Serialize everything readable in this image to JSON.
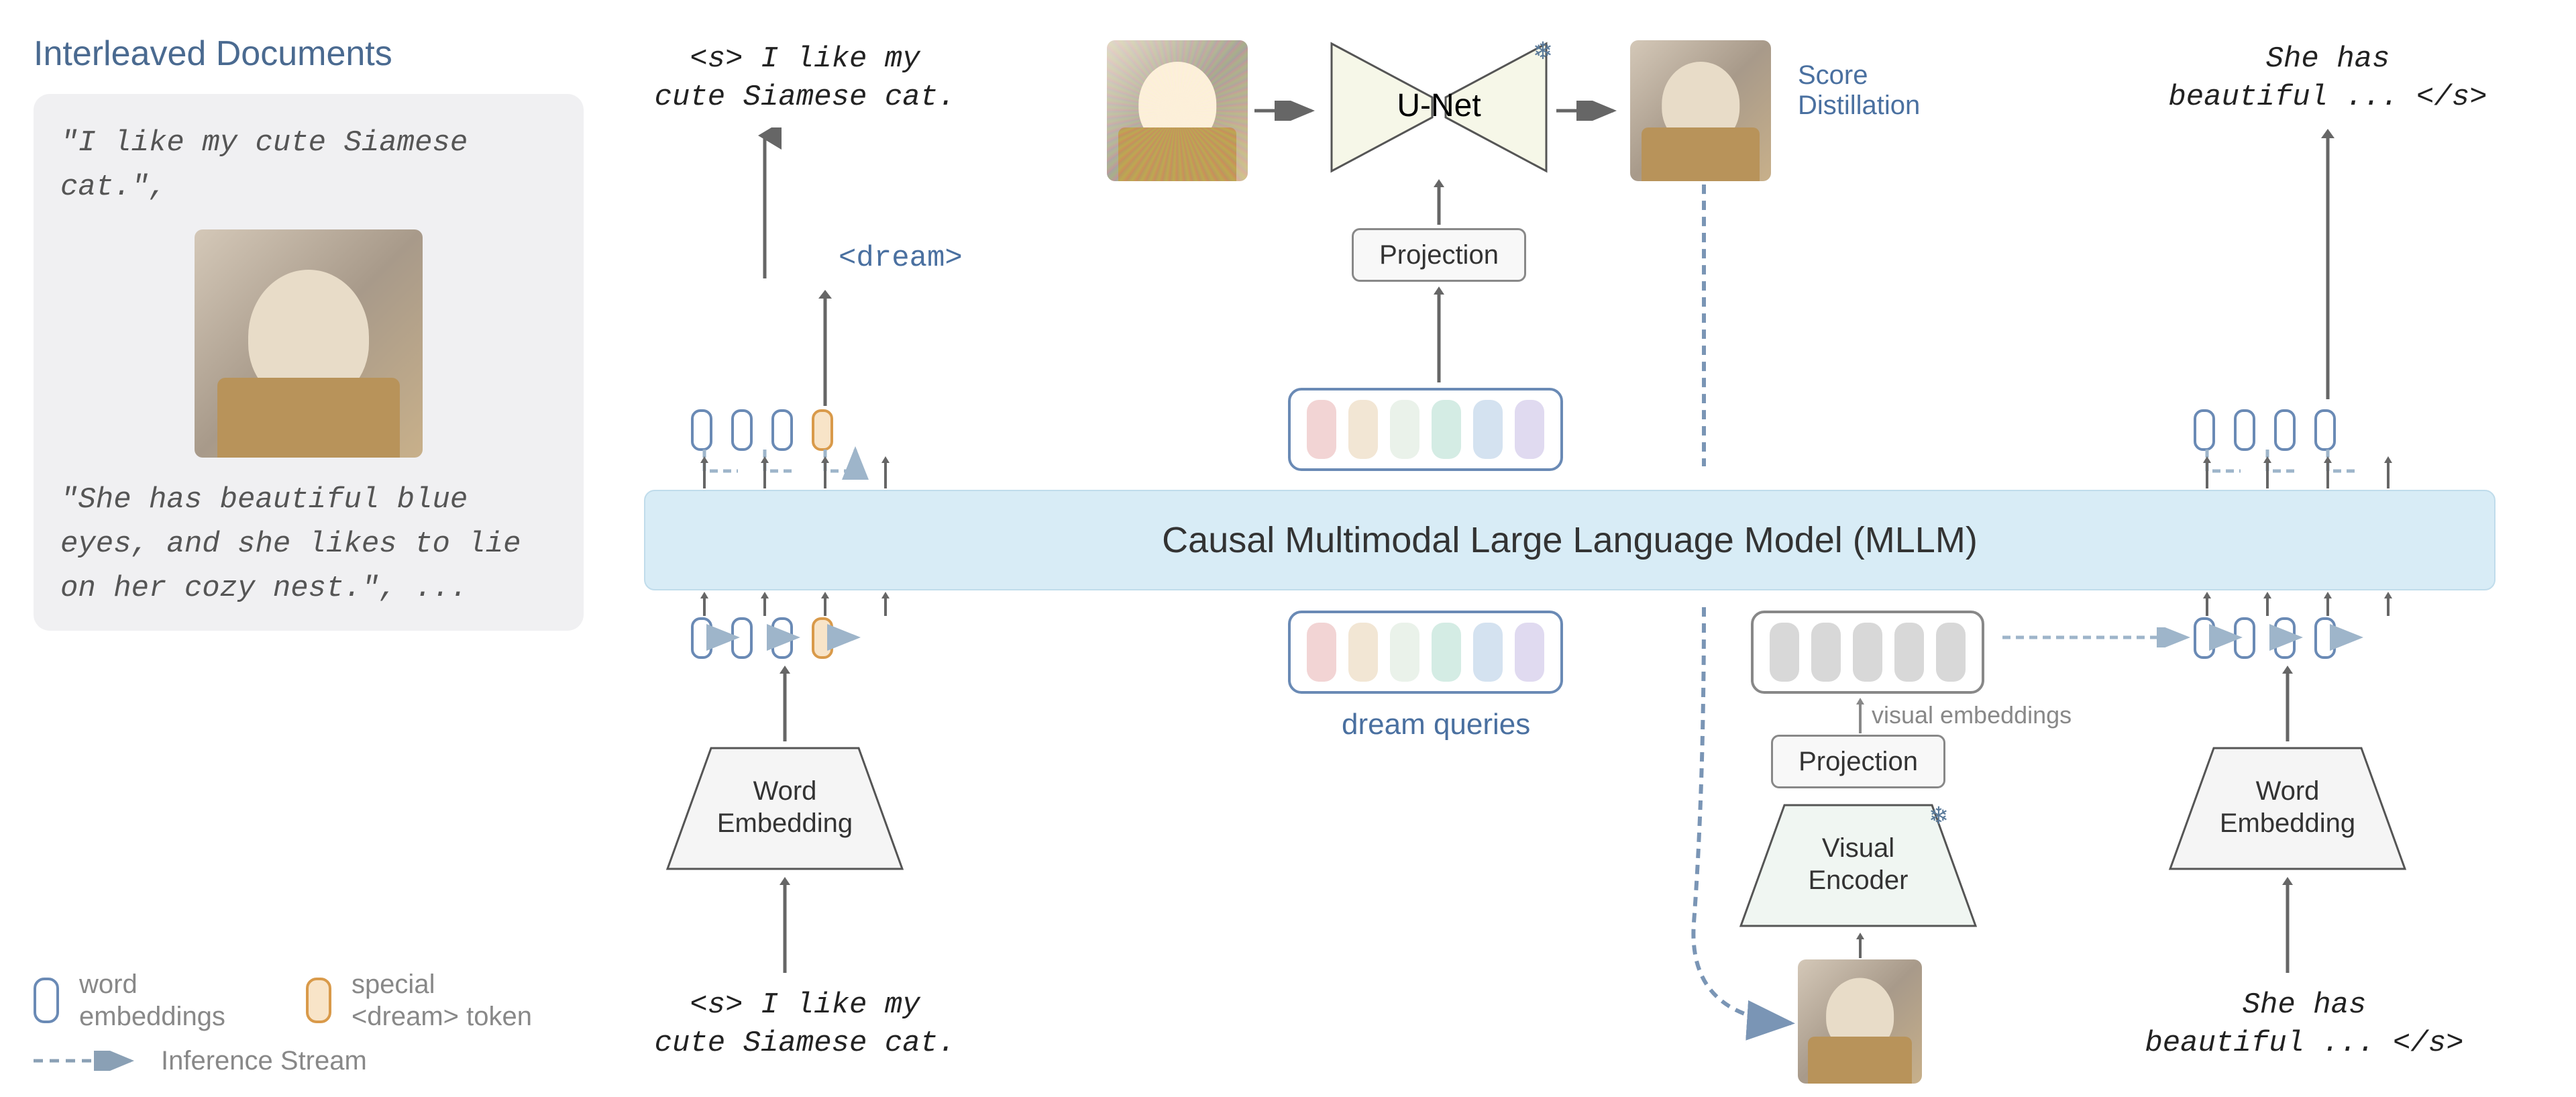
{
  "left": {
    "title": "Interleaved Documents",
    "doc_line1": "\"I like my cute Siamese cat.\",",
    "doc_line2": "\"She has beautiful blue eyes, and she likes to lie on her cozy nest.\", ..."
  },
  "legend": {
    "word_embeddings": "word\nembeddings",
    "dream_token": "special\n<dream> token",
    "inference_stream": "Inference Stream"
  },
  "top": {
    "input_left": "<s> I like my\ncute Siamese cat.",
    "dream_token": "<dream>",
    "unet": "U-Net",
    "projection": "Projection",
    "score_distillation": "Score\nDistillation",
    "output_right": "She has\nbeautiful ... </s>"
  },
  "mllm": "Causal Multimodal Large Language Model (MLLM)",
  "bottom": {
    "input_left": "<s> I like my\ncute Siamese cat.",
    "word_embedding": "Word\nEmbedding",
    "dream_queries": "dream queries",
    "visual_encoder": "Visual\nEncoder",
    "projection": "Projection",
    "visual_embeddings": "visual embeddings",
    "output_right": "She has\nbeautiful ... </s>"
  },
  "colors": {
    "blue": "#6a8ab5",
    "orange": "#d99a4a",
    "gray": "#888"
  }
}
